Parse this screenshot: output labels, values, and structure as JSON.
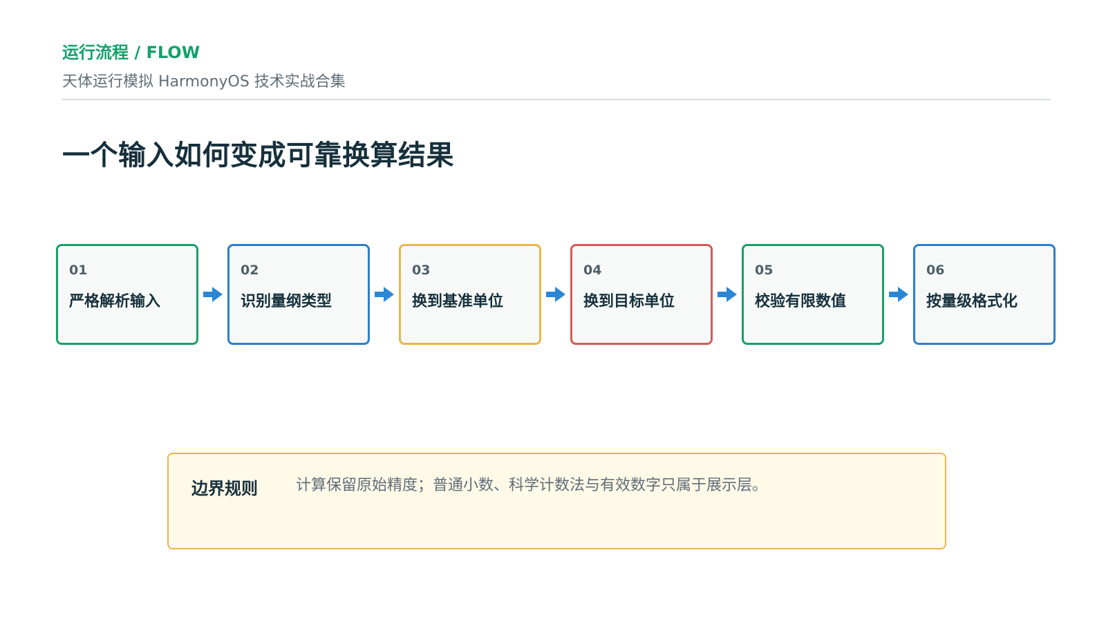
{
  "header": {
    "kicker": "运行流程 / FLOW",
    "subtitle": "天体运行模拟 HarmonyOS 技术实战合集"
  },
  "title": "一个输入如何变成可靠换算结果",
  "flow": {
    "steps": [
      {
        "num": "01",
        "label": "严格解析输入",
        "color": "#1a9e68"
      },
      {
        "num": "02",
        "label": "识别量纲类型",
        "color": "#2b7fc9"
      },
      {
        "num": "03",
        "label": "换到基准单位",
        "color": "#eab64a"
      },
      {
        "num": "04",
        "label": "换到目标单位",
        "color": "#d65a5a"
      },
      {
        "num": "05",
        "label": "校验有限数值",
        "color": "#1a9e68"
      },
      {
        "num": "06",
        "label": "按量级格式化",
        "color": "#2b7fc9"
      }
    ],
    "arrow_color": "#2b86d6",
    "arrow_icon": "arrow-right-icon"
  },
  "note": {
    "label": "边界规则",
    "text": "计算保留原始精度；普通小数、科学计数法与有效数字只属于展示层。",
    "border_color": "#eab64a",
    "background": "#fff9e8"
  },
  "colors": {
    "accent": "#14a06a",
    "title": "#16303c",
    "muted": "#5f6e78"
  }
}
